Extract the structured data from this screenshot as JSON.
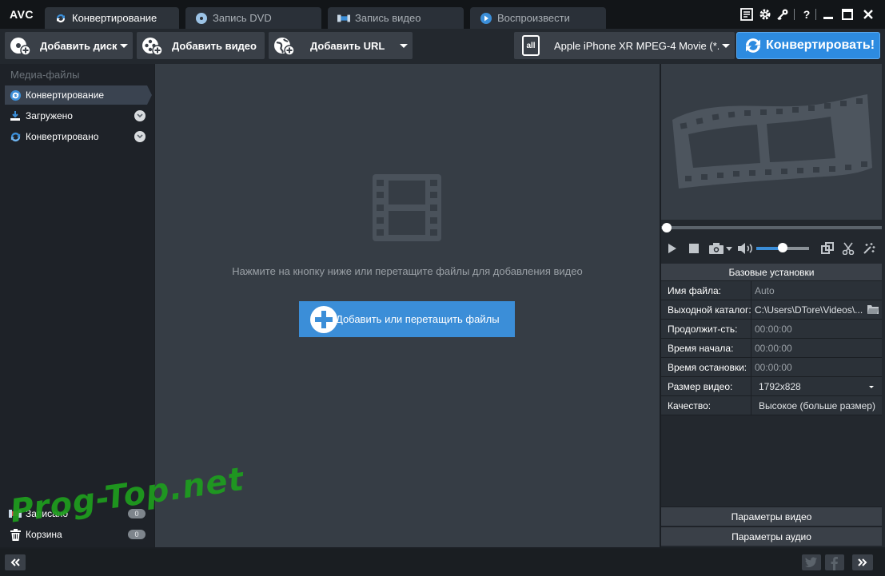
{
  "app": {
    "logo": "AVC"
  },
  "tabs": [
    {
      "label": "Конвертирование",
      "icon": "convert-icon",
      "active": true
    },
    {
      "label": "Запись DVD",
      "icon": "disc-icon",
      "active": false
    },
    {
      "label": "Запись видео",
      "icon": "video-record-icon",
      "active": false
    },
    {
      "label": "Воспроизвести",
      "icon": "play-icon",
      "active": false
    }
  ],
  "toolbar": {
    "add_disc": "Добавить диск",
    "add_video": "Добавить видео",
    "add_url": "Добавить URL",
    "profile": "Apple iPhone XR MPEG-4 Movie (*.m...",
    "profile_icon_text": "all",
    "convert": "Конвертировать!"
  },
  "sidebar": {
    "heading": "Медиа-файлы",
    "items": [
      {
        "label": "Конвертирование",
        "icon": "convert-icon"
      },
      {
        "label": "Загружено",
        "icon": "download-icon"
      },
      {
        "label": "Конвертировано",
        "icon": "converted-icon"
      }
    ],
    "bottom_items": [
      {
        "label": "Записано",
        "count": "0",
        "icon": "recorded-icon"
      },
      {
        "label": "Корзина",
        "count": "0",
        "icon": "trash-icon"
      }
    ]
  },
  "main": {
    "hint": "Нажмите на кнопку ниже или перетащите файлы для добавления видео",
    "add_files": "Добавить или перетащить файлы"
  },
  "player": {
    "volume": 0.5
  },
  "settings": {
    "title": "Базовые установки",
    "rows": [
      {
        "key": "Имя файла:",
        "value": "Auto"
      },
      {
        "key": "Выходной каталог:",
        "value": "C:\\Users\\DTore\\Videos\\..."
      },
      {
        "key": "Продолжит-сть:",
        "value": "00:00:00"
      },
      {
        "key": "Время начала:",
        "value": "00:00:00"
      },
      {
        "key": "Время остановки:",
        "value": "00:00:00"
      },
      {
        "key": "Размер видео:",
        "value": "1792x828"
      },
      {
        "key": "Качество:",
        "value": "Высокое (больше размер)"
      }
    ],
    "video_params": "Параметры видео",
    "audio_params": "Параметры аудио"
  },
  "watermark": "Prog-Top.net",
  "colors": {
    "accent": "#3b8ed8",
    "convert": "#2d8be0"
  }
}
